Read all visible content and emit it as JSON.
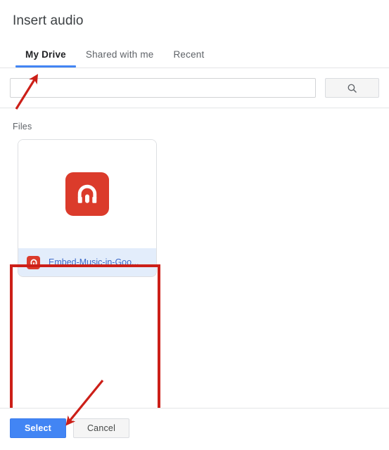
{
  "dialog": {
    "title": "Insert audio"
  },
  "tabs": [
    {
      "label": "My Drive",
      "active": true
    },
    {
      "label": "Shared with me",
      "active": false
    },
    {
      "label": "Recent",
      "active": false
    }
  ],
  "search": {
    "value": "",
    "placeholder": "",
    "button_icon": "search-icon"
  },
  "files_section": {
    "label": "Files",
    "items": [
      {
        "name": "Embed-Music-in-Goo...",
        "icon": "audio-file-icon",
        "selected": true
      }
    ]
  },
  "footer": {
    "select_label": "Select",
    "cancel_label": "Cancel"
  },
  "colors": {
    "accent_blue": "#4285f4",
    "tab_underline": "#4285f4",
    "audio_red": "#db3b2b",
    "annotation_red": "#cc1f18",
    "selected_row": "#e3edfb",
    "file_name_blue": "#3c69c8"
  },
  "annotations": {
    "arrow_to_my_drive_tab": "red-arrow-up-right",
    "arrow_to_select_button": "red-arrow-down-left",
    "highlight_box_on_file_card": "red-rectangle"
  }
}
